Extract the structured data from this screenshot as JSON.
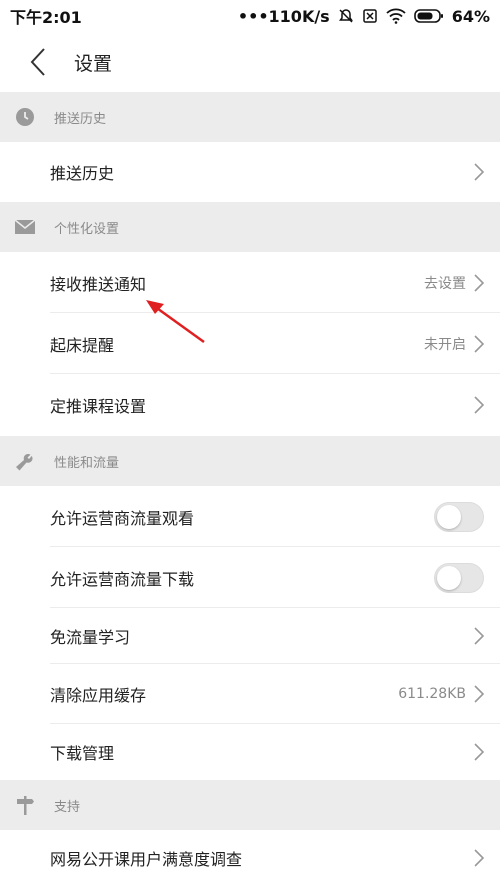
{
  "status_bar": {
    "time": "下午2:01",
    "network_speed": "•••110K/s",
    "battery": "64%"
  },
  "header": {
    "title": "设置"
  },
  "sections": [
    {
      "title": "推送历史",
      "icon": "clock-icon"
    },
    {
      "title": "个性化设置",
      "icon": "envelope-icon"
    },
    {
      "title": "性能和流量",
      "icon": "wrench-icon"
    },
    {
      "title": "支持",
      "icon": "signpost-icon"
    }
  ],
  "rows": {
    "push_history": {
      "label": "推送历史"
    },
    "receive_push": {
      "label": "接收推送通知",
      "value": "去设置"
    },
    "wake_reminder": {
      "label": "起床提醒",
      "value": "未开启"
    },
    "scheduled_push": {
      "label": "定推课程设置"
    },
    "allow_carrier_watch": {
      "label": "允许运营商流量观看",
      "enabled": false
    },
    "allow_carrier_download": {
      "label": "允许运营商流量下载",
      "enabled": false
    },
    "free_traffic_learning": {
      "label": "免流量学习"
    },
    "clear_cache": {
      "label": "清除应用缓存",
      "value": "611.28KB"
    },
    "download_management": {
      "label": "下载管理"
    },
    "satisfaction_survey": {
      "label": "网易公开课用户满意度调查"
    }
  },
  "colors": {
    "section_bg": "#ececec",
    "annotation_arrow": "#e02020"
  }
}
